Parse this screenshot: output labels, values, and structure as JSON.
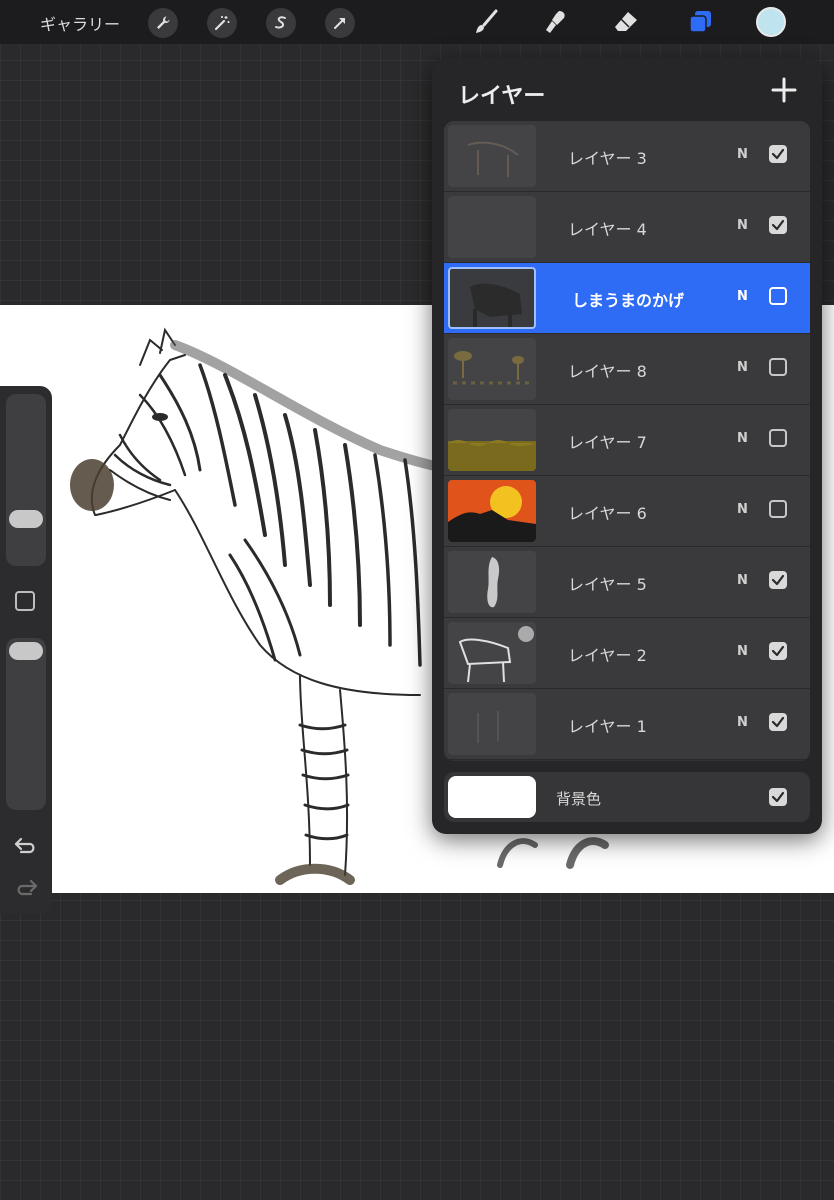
{
  "toolbar": {
    "gallery_label": "ギャラリー",
    "left_tools": [
      "wrench-icon",
      "magic-wand-icon",
      "selection-icon",
      "transform-arrow-icon"
    ],
    "right_tools": [
      "brush-icon",
      "smudge-icon",
      "eraser-icon",
      "layers-icon"
    ],
    "accent_color": "#2f6cf6",
    "current_color": "#bfe3ef"
  },
  "sidebar": {
    "brush_size_level": 0.68,
    "opacity_level": 0.95,
    "icons": [
      "modify-square-icon",
      "undo-icon",
      "redo-icon"
    ]
  },
  "layers_panel": {
    "title": "レイヤー",
    "add_icon": "plus-icon",
    "layers": [
      {
        "name": "レイヤー 3",
        "blend": "N",
        "visible": true,
        "active": false
      },
      {
        "name": "レイヤー 4",
        "blend": "N",
        "visible": true,
        "active": false
      },
      {
        "name": "しまうまのかげ",
        "blend": "N",
        "visible": false,
        "active": true
      },
      {
        "name": "レイヤー 8",
        "blend": "N",
        "visible": false,
        "active": false
      },
      {
        "name": "レイヤー 7",
        "blend": "N",
        "visible": false,
        "active": false
      },
      {
        "name": "レイヤー 6",
        "blend": "N",
        "visible": false,
        "active": false
      },
      {
        "name": "レイヤー 5",
        "blend": "N",
        "visible": true,
        "active": false
      },
      {
        "name": "レイヤー 2",
        "blend": "N",
        "visible": true,
        "active": false
      },
      {
        "name": "レイヤー 1",
        "blend": "N",
        "visible": true,
        "active": false
      }
    ],
    "background": {
      "name": "背景色",
      "visible": true,
      "color": "#ffffff"
    }
  }
}
